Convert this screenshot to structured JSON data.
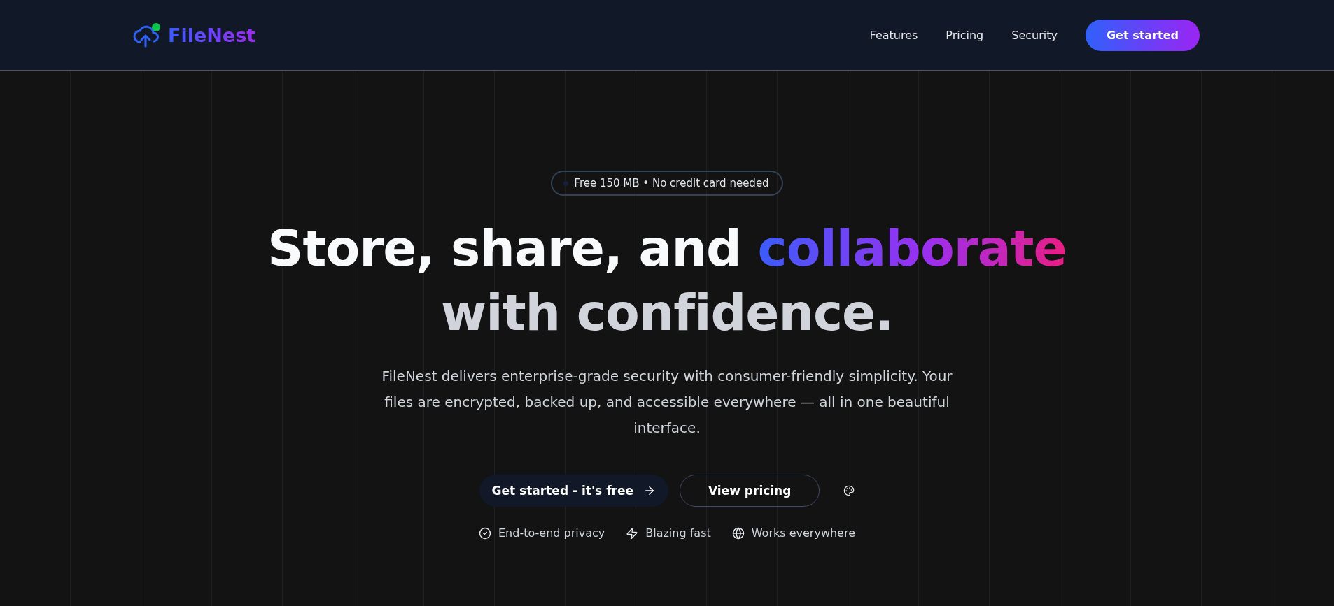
{
  "brand": {
    "name": "FileNest"
  },
  "nav": {
    "links": [
      "Features",
      "Pricing",
      "Security"
    ],
    "cta": "Get started"
  },
  "hero": {
    "badge": "Free 150 MB • No credit card needed",
    "headline": {
      "lead": "Store, share, and",
      "highlight": "collaborate",
      "tail": "with confidence."
    },
    "description": "FileNest delivers enterprise-grade security with consumer-friendly simplicity. Your files are encrypted, backed up, and accessible everywhere — all in one beautiful interface.",
    "primary_button": "Get started - it's free",
    "secondary_button": "View pricing",
    "features": [
      {
        "kind": "check",
        "label": "End-to-end privacy"
      },
      {
        "kind": "bolt",
        "label": "Blazing fast"
      },
      {
        "kind": "globe",
        "label": "Works everywhere"
      }
    ]
  }
}
